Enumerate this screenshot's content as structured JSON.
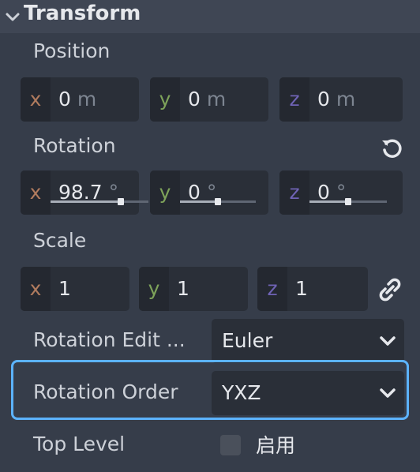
{
  "section": {
    "title": "Transform"
  },
  "position": {
    "label": "Position",
    "fields": [
      {
        "axis": "x",
        "value": "0",
        "unit": "m"
      },
      {
        "axis": "y",
        "value": "0",
        "unit": "m"
      },
      {
        "axis": "z",
        "value": "0",
        "unit": "m"
      }
    ]
  },
  "rotation": {
    "label": "Rotation",
    "fields": [
      {
        "axis": "x",
        "value": "98.7",
        "unit": "°",
        "slider": 0.72
      },
      {
        "axis": "y",
        "value": "0",
        "unit": "°",
        "slider": 0.5
      },
      {
        "axis": "z",
        "value": "0",
        "unit": "°",
        "slider": 0.5
      }
    ]
  },
  "scale": {
    "label": "Scale",
    "fields": [
      {
        "axis": "x",
        "value": "1"
      },
      {
        "axis": "y",
        "value": "1"
      },
      {
        "axis": "z",
        "value": "1"
      }
    ]
  },
  "rotation_edit": {
    "label": "Rotation Edit ...",
    "value": "Euler"
  },
  "rotation_order": {
    "label": "Rotation Order",
    "value": "YXZ"
  },
  "top_level": {
    "label": "Top Level",
    "checkbox_label": "启用",
    "checked": false
  },
  "colors": {
    "accent": "#5cb3ff",
    "axis_x": "#b07b5e",
    "axis_y": "#7ea35a",
    "axis_z": "#6f63b5"
  }
}
